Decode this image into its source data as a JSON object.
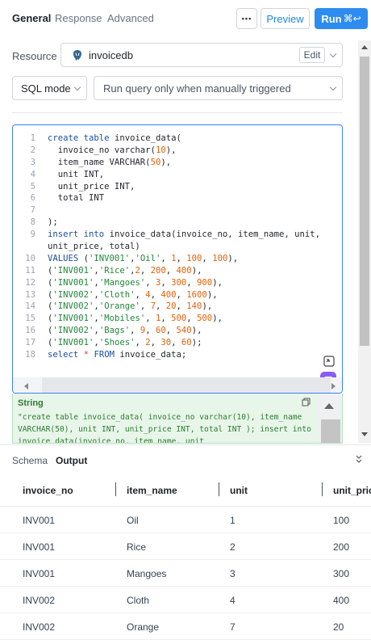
{
  "tabs": [
    {
      "label": "General"
    },
    {
      "label": "Response"
    },
    {
      "label": "Advanced"
    }
  ],
  "toolbar": {
    "more_label": "•••",
    "preview_label": "Preview",
    "run_label": "Run",
    "run_shortcut": "⌘↩"
  },
  "resource": {
    "label": "Resource",
    "name": "invoicedb",
    "edit_label": "Edit",
    "icon": "postgres-elephant-icon"
  },
  "query": {
    "mode": "SQL mode",
    "trigger": "Run query only when manually triggered"
  },
  "editor": {
    "lines": [
      {
        "n": "1",
        "text": "create table invoice_data("
      },
      {
        "n": "2",
        "text": "  invoice_no varchar(10),"
      },
      {
        "n": "3",
        "text": "  item_name VARCHAR(50),"
      },
      {
        "n": "4",
        "text": "  unit INT,"
      },
      {
        "n": "5",
        "text": "  unit_price INT,"
      },
      {
        "n": "6",
        "text": "  total INT"
      },
      {
        "n": "7",
        "text": ""
      },
      {
        "n": "8",
        "text": ");"
      },
      {
        "n": "9",
        "text": "insert into invoice_data(invoice_no, item_name, unit, unit_price, total)"
      },
      {
        "n": "10",
        "text": "VALUES ('INV001','Oil', 1, 100, 100),"
      },
      {
        "n": "11",
        "text": "('INV001','Rice',2, 200, 400),"
      },
      {
        "n": "12",
        "text": "('INV001','Mangoes', 3, 300, 900),"
      },
      {
        "n": "13",
        "text": "('INV002','Cloth', 4, 400, 1600),"
      },
      {
        "n": "14",
        "text": "('INV002','Orange', 7, 20, 140),"
      },
      {
        "n": "15",
        "text": "('INV001','Mobiles', 1, 500, 500),"
      },
      {
        "n": "16",
        "text": "('INV002','Bags', 9, 60, 540),"
      },
      {
        "n": "17",
        "text": "('INV001','Shoes', 2, 30, 60);"
      },
      {
        "n": "18",
        "text": "select * FROM invoice_data;"
      }
    ]
  },
  "string_preview": {
    "title": "String",
    "text": "\"create table invoice_data( invoice_no varchar(10), item_name VARCHAR(50), unit INT, unit_price INT, total INT ); insert into invoice_data(invoice_no, item_name, unit"
  },
  "bottom": {
    "tabs": [
      {
        "label": "Schema"
      },
      {
        "label": "Output"
      }
    ],
    "columns": [
      "invoice_no",
      "item_name",
      "unit",
      "unit_price"
    ],
    "rows": [
      [
        "INV001",
        "Oil",
        "1",
        "100"
      ],
      [
        "INV001",
        "Rice",
        "2",
        "200"
      ],
      [
        "INV001",
        "Mangoes",
        "3",
        "300"
      ],
      [
        "INV002",
        "Cloth",
        "4",
        "400"
      ],
      [
        "INV002",
        "Orange",
        "7",
        "20"
      ]
    ]
  },
  "colors": {
    "accent": "#2d8cf0",
    "string_bg": "#e8f5e9",
    "string_fg": "#2e7d32",
    "ai_badge": "#8b5cf6"
  }
}
